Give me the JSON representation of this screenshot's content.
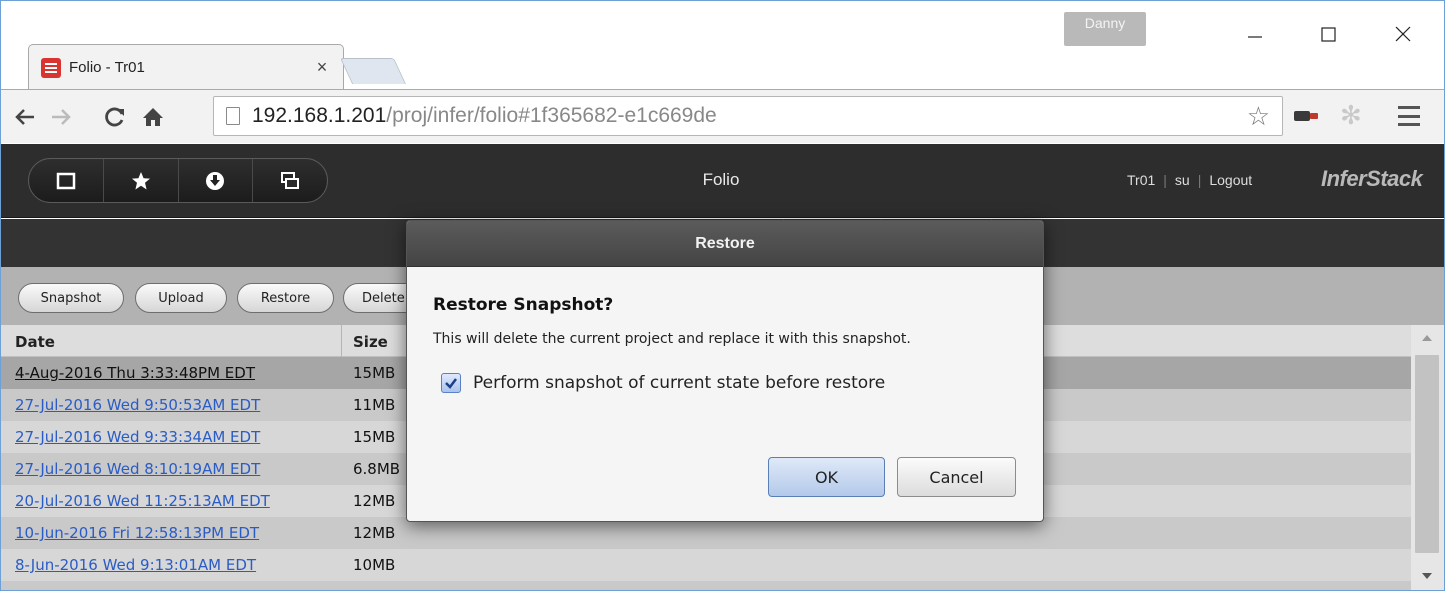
{
  "browser": {
    "profile_name": "Danny",
    "tab_title": "Folio - Tr01",
    "tab_close": "×",
    "url_host": "192.168.1.201",
    "url_path": "/proj/infer/folio#1f365682-e1c669de"
  },
  "app": {
    "title": "Folio",
    "user": "Tr01",
    "role": "su",
    "logout": "Logout",
    "brand": "InferStack",
    "toolbar_buttons": [
      "Snapshot",
      "Upload",
      "Restore",
      "Delete"
    ]
  },
  "table": {
    "headers": {
      "date": "Date",
      "size": "Size"
    },
    "rows": [
      {
        "date": "4-Aug-2016 Thu 3:33:48PM EDT",
        "size": "15MB"
      },
      {
        "date": "27-Jul-2016 Wed 9:50:53AM EDT",
        "size": "11MB"
      },
      {
        "date": "27-Jul-2016 Wed 9:33:34AM EDT",
        "size": "15MB"
      },
      {
        "date": "27-Jul-2016 Wed 8:10:19AM EDT",
        "size": "6.8MB"
      },
      {
        "date": "20-Jul-2016 Wed 11:25:13AM EDT",
        "size": "12MB"
      },
      {
        "date": "10-Jun-2016 Fri 12:58:13PM EDT",
        "size": "12MB"
      },
      {
        "date": "8-Jun-2016 Wed 9:13:01AM EDT",
        "size": "10MB"
      }
    ]
  },
  "dialog": {
    "title": "Restore",
    "heading": "Restore Snapshot?",
    "message": "This will delete the current project and replace it with this snapshot.",
    "checkbox_label": "Perform snapshot of current state before restore",
    "checkbox_checked": true,
    "ok_label": "OK",
    "cancel_label": "Cancel"
  },
  "colors": {
    "link": "#2a5cc6",
    "header_bg": "#2d2d2d",
    "toolbar_bg": "#b2b2b2",
    "ok_button": "#b3c9ea"
  }
}
